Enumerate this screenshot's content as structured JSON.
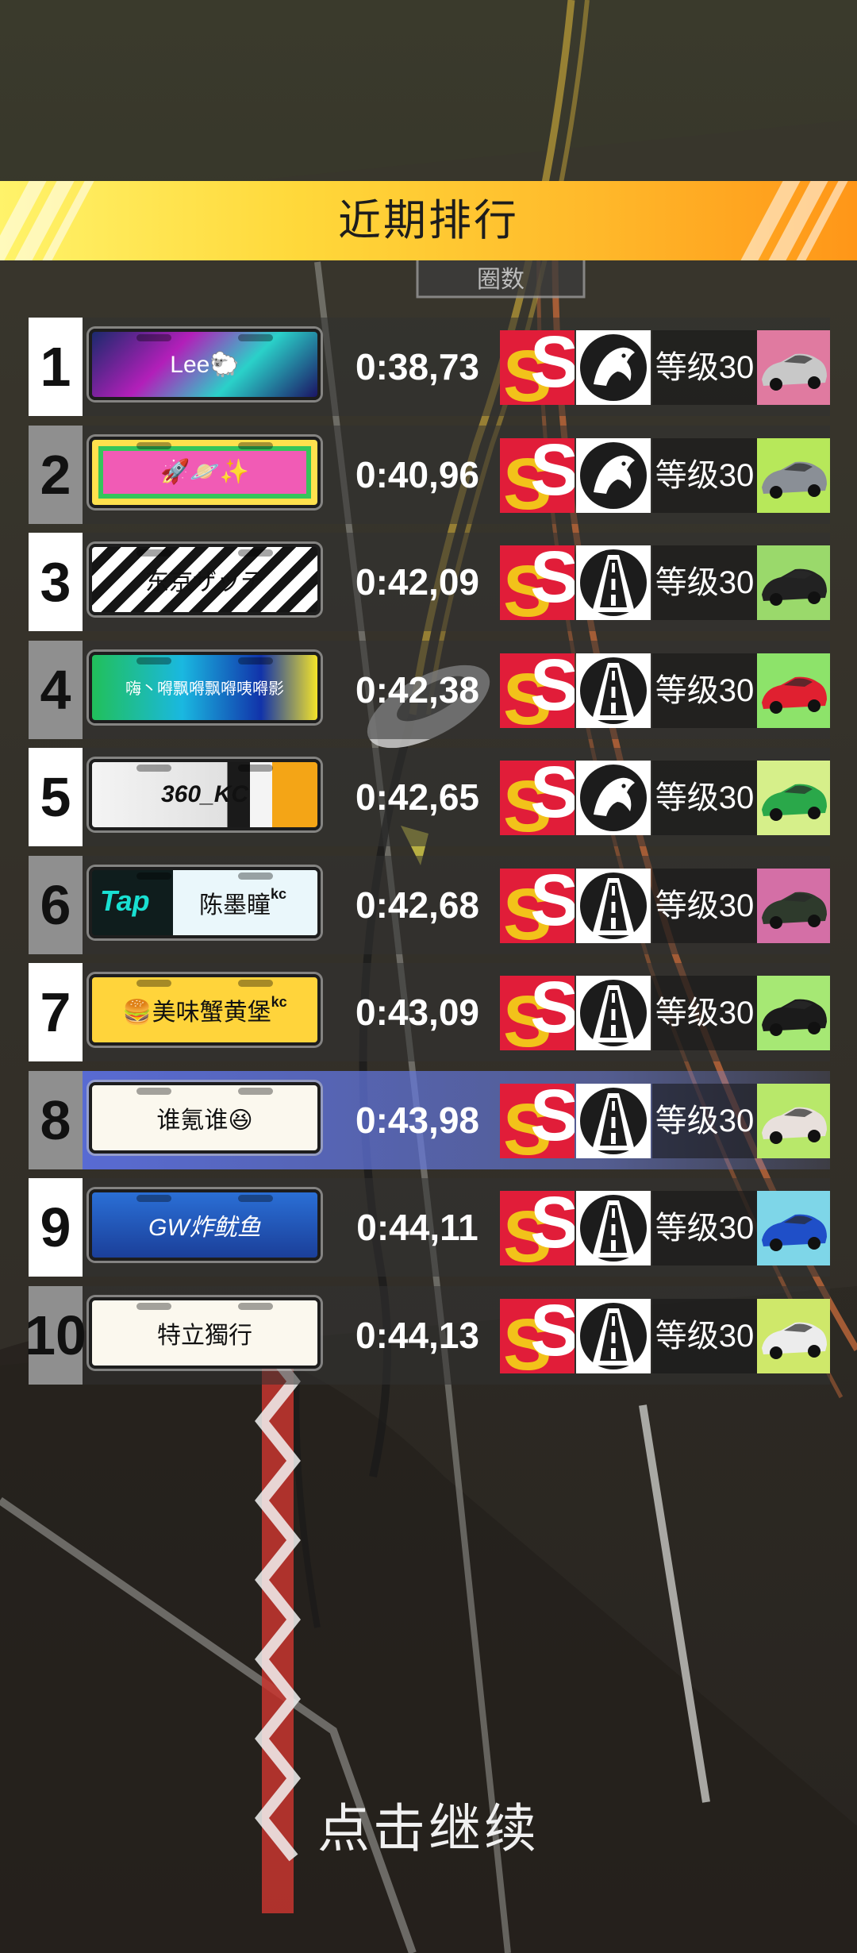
{
  "title": "近期排行",
  "footer": "点击继续",
  "background_sign": "圈数",
  "colors": {
    "banner_start": "#fff36a",
    "banner_end": "#ff9618",
    "badge_red": "#e11d39",
    "badge_gold": "#f2c21a",
    "highlight": "#5a6edc"
  },
  "entries": [
    {
      "rank": "1",
      "name": "Lee🐑",
      "time": "0:38,73",
      "level": "等级30",
      "icon": "horse-icon",
      "car_color": "#c8c8c8",
      "car_bg": "#e07aa0",
      "plate_style": "galaxy"
    },
    {
      "rank": "2",
      "name": "🚀🪐✨",
      "time": "0:40,96",
      "level": "等级30",
      "icon": "horse-icon",
      "car_color": "#8a8f96",
      "car_bg": "#b7e85a",
      "plate_style": "rainbow"
    },
    {
      "rank": "3",
      "name": "东京ザッテ",
      "time": "0:42,09",
      "level": "等级30",
      "icon": "road-icon",
      "car_color": "#222222",
      "car_bg": "#9ad96b",
      "plate_style": "stripes"
    },
    {
      "rank": "4",
      "name": "嗨丶嘚飘嘚飘嘚咦嘚影",
      "time": "0:42,38",
      "level": "等级30",
      "icon": "road-icon",
      "car_color": "#e02030",
      "car_bg": "#8de36a",
      "plate_style": "neon"
    },
    {
      "rank": "5",
      "name": "360_KC",
      "time": "0:42,65",
      "level": "等级30",
      "icon": "horse-icon",
      "car_color": "#2aa84a",
      "car_bg": "#d6ef8a",
      "plate_style": "checker"
    },
    {
      "rank": "6",
      "name": "陈墨瞳",
      "name_sup": "kc",
      "plate_badge": "Tap",
      "time": "0:42,68",
      "level": "等级30",
      "icon": "road-icon",
      "car_color": "#2e3a2c",
      "car_bg": "#d46fa6",
      "plate_style": "tap"
    },
    {
      "rank": "7",
      "name": "🍔美味蟹黄堡",
      "name_sup": "kc",
      "time": "0:43,09",
      "level": "等级30",
      "icon": "road-icon",
      "car_color": "#1b1b1b",
      "car_bg": "#a6e874",
      "plate_style": "yellow"
    },
    {
      "rank": "8",
      "name": "谁氪谁😆",
      "time": "0:43,98",
      "level": "等级30",
      "icon": "road-icon",
      "car_color": "#e8e0dc",
      "car_bg": "#b8e86a",
      "plate_style": "plain",
      "highlight": true
    },
    {
      "rank": "9",
      "name": "GW炸鱿鱼",
      "time": "0:44,11",
      "level": "等级30",
      "icon": "road-icon",
      "car_color": "#1f4fc8",
      "car_bg": "#7ed6e8",
      "plate_style": "blue"
    },
    {
      "rank": "10",
      "name": "特立獨行",
      "time": "0:44,13",
      "level": "等级30",
      "icon": "road-icon",
      "car_color": "#ececec",
      "car_bg": "#cfe86a",
      "plate_style": "plain"
    }
  ]
}
